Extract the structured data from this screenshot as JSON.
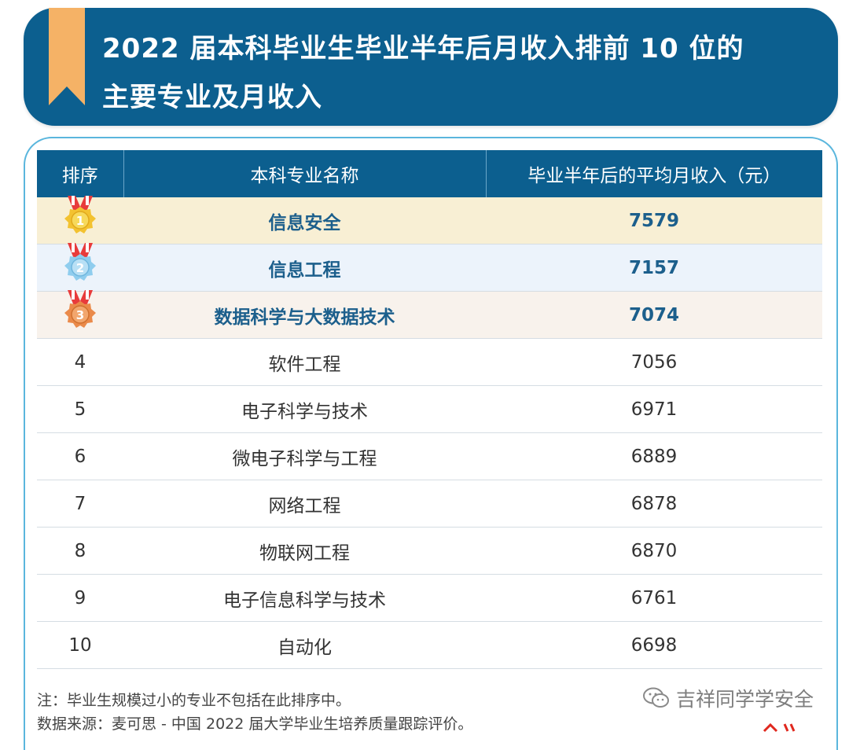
{
  "header": {
    "title_line1": "2022 届本科毕业生毕业半年后月收入排前 10 位的",
    "title_line2": "主要专业及月收入",
    "banner_color": "#0c5f8f",
    "ribbon_color": "#f5b266"
  },
  "table": {
    "headers": {
      "rank": "排序",
      "major": "本科专业名称",
      "income": "毕业半年后的平均月收入（元）"
    },
    "rows": [
      {
        "rank": "1",
        "major": "信息安全",
        "income": "7579",
        "medal": "gold"
      },
      {
        "rank": "2",
        "major": "信息工程",
        "income": "7157",
        "medal": "silver"
      },
      {
        "rank": "3",
        "major": "数据科学与大数据技术",
        "income": "7074",
        "medal": "bronze"
      },
      {
        "rank": "4",
        "major": "软件工程",
        "income": "7056"
      },
      {
        "rank": "5",
        "major": "电子科学与技术",
        "income": "6971"
      },
      {
        "rank": "6",
        "major": "微电子科学与工程",
        "income": "6889"
      },
      {
        "rank": "7",
        "major": "网络工程",
        "income": "6878"
      },
      {
        "rank": "8",
        "major": "物联网工程",
        "income": "6870"
      },
      {
        "rank": "9",
        "major": "电子信息科学与技术",
        "income": "6761"
      },
      {
        "rank": "10",
        "major": "自动化",
        "income": "6698"
      }
    ]
  },
  "notes": {
    "note": "注：毕业生规模过小的专业不包括在此排序中。",
    "source": "数据来源：麦可思 - 中国 2022 届大学毕业生培养质量跟踪评价。"
  },
  "watermark": {
    "text": "吉祥同学学安全",
    "icon": "wechat-icon"
  }
}
